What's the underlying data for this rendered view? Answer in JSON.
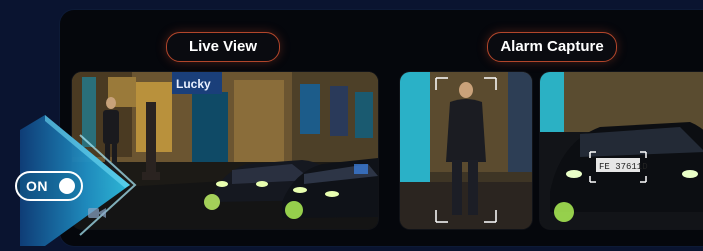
{
  "labels": {
    "live_view": "Live View",
    "alarm_capture": "Alarm Capture"
  },
  "toggle": {
    "label": "ON",
    "state": "on"
  },
  "plate_text": "FE 37611D",
  "store_sign": "Lucky",
  "colors": {
    "accent_border": "#b2462b",
    "arrow": "#2bb3d6",
    "background": "#0a1430"
  },
  "icons": [
    "video-camera-icon",
    "play-arrow-icon"
  ]
}
